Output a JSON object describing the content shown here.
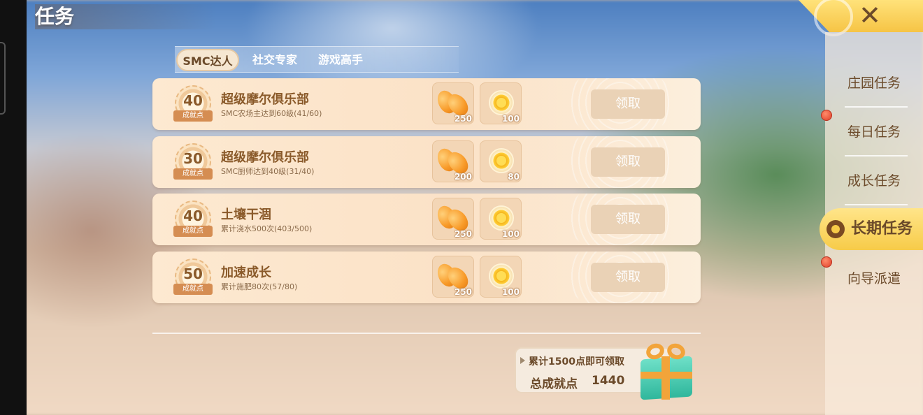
{
  "header": {
    "title": "任务",
    "close_icon": "close-icon"
  },
  "tabs": [
    {
      "label": "SMC达人",
      "active": true
    },
    {
      "label": "社交专家",
      "active": false
    },
    {
      "label": "游戏高手",
      "active": false
    }
  ],
  "sidebar": {
    "items": [
      {
        "label": "庄园任务",
        "active": false,
        "red_dot": false
      },
      {
        "label": "每日任务",
        "active": false,
        "red_dot": true
      },
      {
        "label": "成长任务",
        "active": false,
        "red_dot": false
      },
      {
        "label": "长期任务",
        "active": true,
        "red_dot": false
      },
      {
        "label": "向导派遣",
        "active": false,
        "red_dot": true
      }
    ]
  },
  "tasks": [
    {
      "points": "40",
      "points_label": "成就点",
      "name": "超级摩尔俱乐部",
      "desc": "SMC农场主达到60级(41/60)",
      "reward1": "250",
      "reward2": "100",
      "button": "领取"
    },
    {
      "points": "30",
      "points_label": "成就点",
      "name": "超级摩尔俱乐部",
      "desc": "SMC厨师达到40级(31/40)",
      "reward1": "200",
      "reward2": "80",
      "button": "领取"
    },
    {
      "points": "40",
      "points_label": "成就点",
      "name": "土壤干涸",
      "desc": "累计浇水500次(403/500)",
      "reward1": "250",
      "reward2": "100",
      "button": "领取"
    },
    {
      "points": "50",
      "points_label": "成就点",
      "name": "加速成长",
      "desc": "累计施肥80次(57/80)",
      "reward1": "250",
      "reward2": "100",
      "button": "领取"
    }
  ],
  "achievement": {
    "hint": "累计1500点即可领取",
    "total_label": "总成就点",
    "total_value": "1440",
    "gift_icon": "gift-box-icon"
  },
  "colors": {
    "accent": "#f7cb48",
    "text_brown": "#6b4a2a",
    "card_bg": "#fde9d1",
    "claim_disabled": "#ead2b6",
    "red_dot": "#e0402a"
  }
}
